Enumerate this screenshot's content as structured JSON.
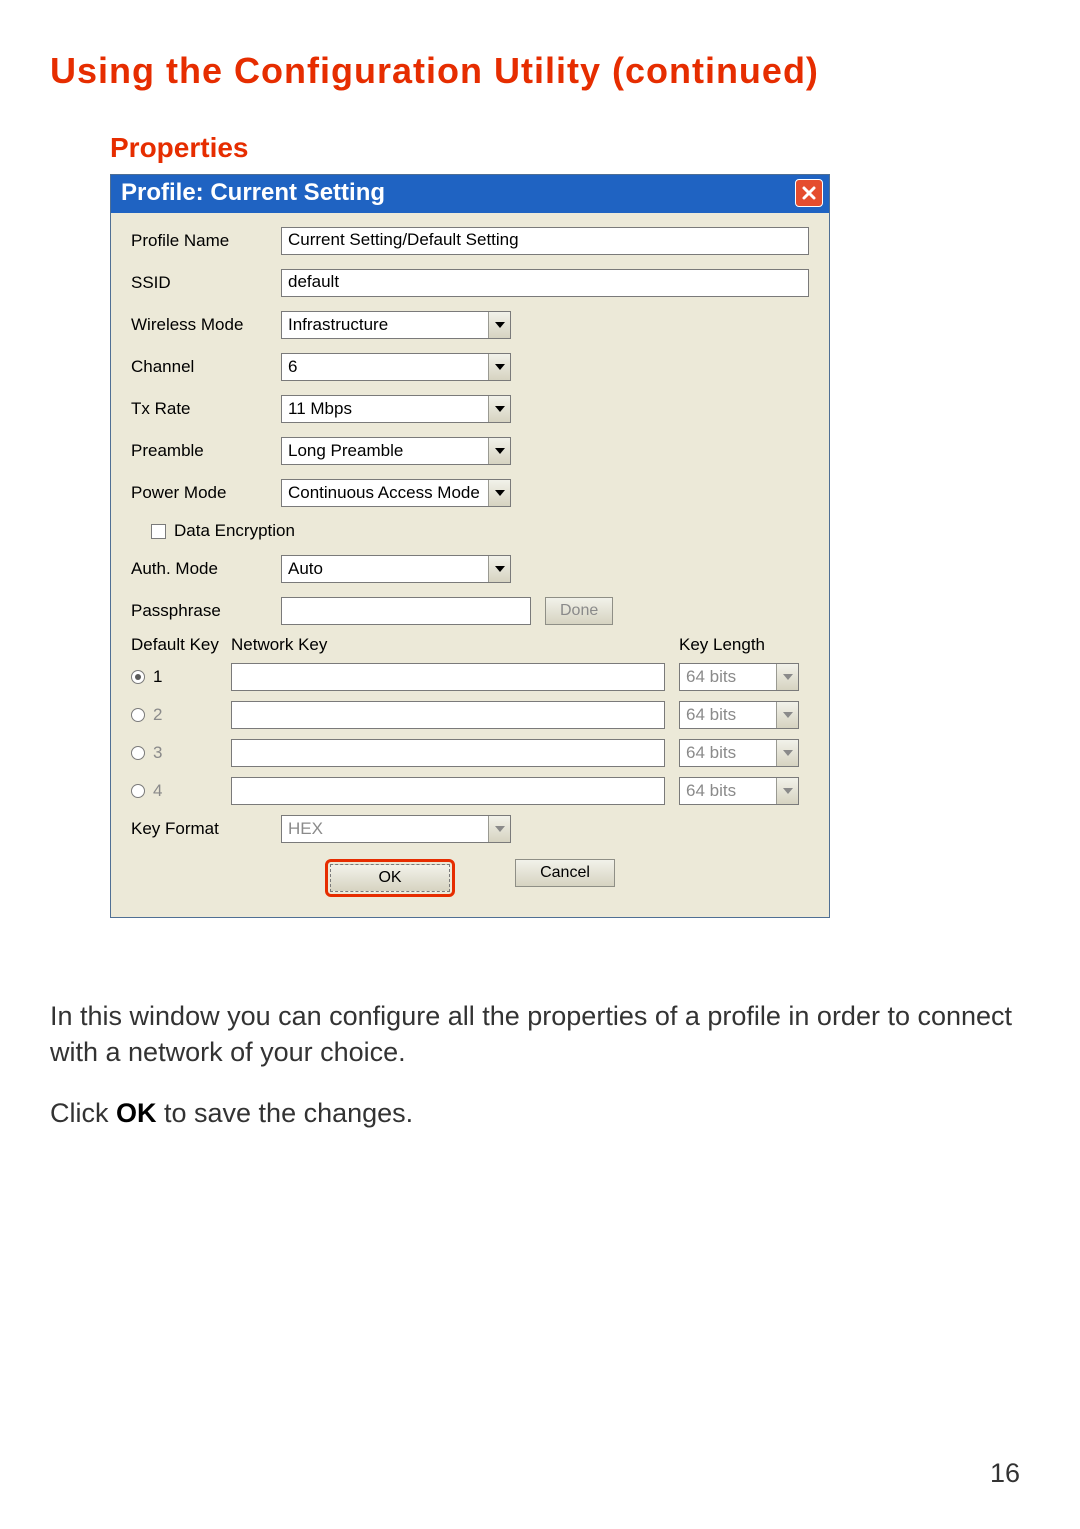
{
  "page": {
    "title": "Using the Configuration Utility (continued)",
    "subheading": "Properties",
    "page_number": "16"
  },
  "dialog": {
    "title": "Profile:  Current Setting",
    "close_icon": "close-icon",
    "fields": {
      "profile_name": {
        "label": "Profile Name",
        "value": "Current Setting/Default Setting"
      },
      "ssid": {
        "label": "SSID",
        "value": "default"
      },
      "wireless_mode": {
        "label": "Wireless Mode",
        "value": "Infrastructure"
      },
      "channel": {
        "label": "Channel",
        "value": "6"
      },
      "tx_rate": {
        "label": "Tx Rate",
        "value": "11 Mbps"
      },
      "preamble": {
        "label": "Preamble",
        "value": "Long Preamble"
      },
      "power_mode": {
        "label": "Power Mode",
        "value": "Continuous Access Mode"
      },
      "data_encryption": {
        "label": "Data Encryption",
        "checked": false
      },
      "auth_mode": {
        "label": "Auth. Mode",
        "value": "Auto"
      },
      "passphrase": {
        "label": "Passphrase",
        "value": "",
        "done_label": "Done"
      },
      "default_key": {
        "label": "Default Key",
        "network_key_label": "Network Key",
        "key_length_label": "Key Length"
      },
      "keys": [
        {
          "index": "1",
          "selected": true,
          "value": "",
          "length": "64 bits"
        },
        {
          "index": "2",
          "selected": false,
          "value": "",
          "length": "64 bits"
        },
        {
          "index": "3",
          "selected": false,
          "value": "",
          "length": "64 bits"
        },
        {
          "index": "4",
          "selected": false,
          "value": "",
          "length": "64 bits"
        }
      ],
      "key_format": {
        "label": "Key Format",
        "value": "HEX"
      }
    },
    "buttons": {
      "ok": "OK",
      "cancel": "Cancel"
    }
  },
  "body": {
    "p1": "In this window you can configure all the properties of a profile in order to connect with a network of your choice.",
    "p2a": "Click ",
    "p2b": "OK",
    "p2c": " to save the changes."
  }
}
